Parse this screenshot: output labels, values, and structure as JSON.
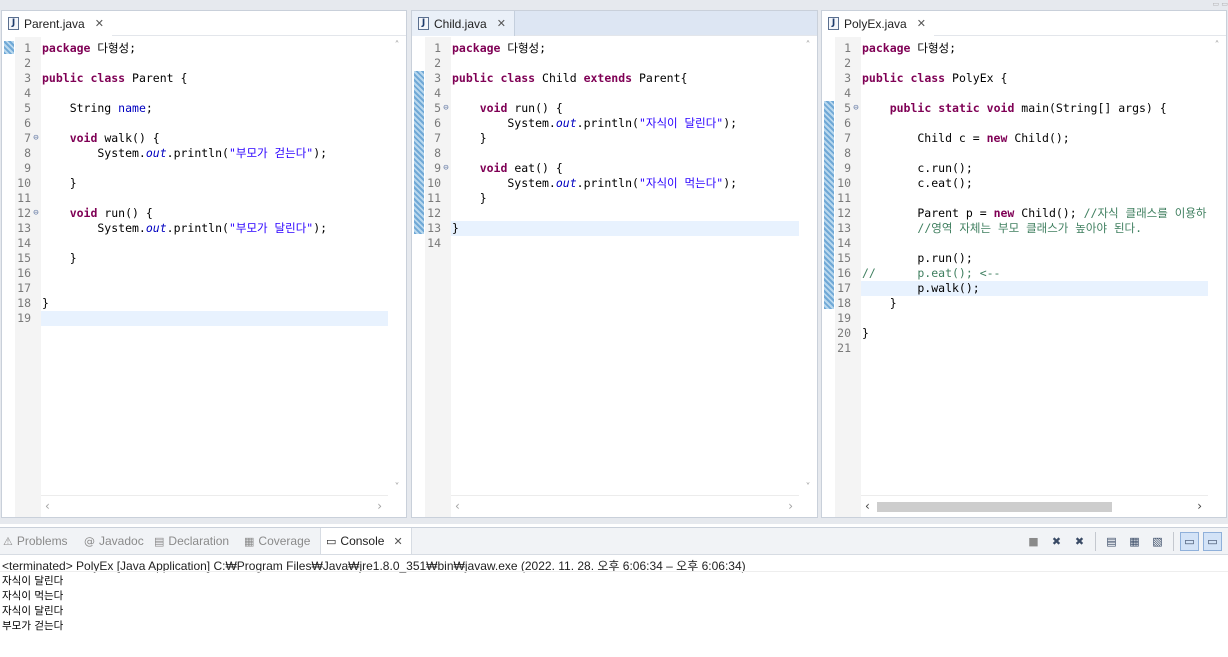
{
  "editors": [
    {
      "tab_label": "Parent.java",
      "lines": [
        {
          "n": "1",
          "html": "<span class=\"kw\">package</span> 다형성;"
        },
        {
          "n": "2",
          "html": ""
        },
        {
          "n": "3",
          "html": "<span class=\"kw\">public</span> <span class=\"kw\">class</span> Parent {"
        },
        {
          "n": "4",
          "html": ""
        },
        {
          "n": "5",
          "html": "    String <span class=\"fld\">name</span>;"
        },
        {
          "n": "6",
          "html": ""
        },
        {
          "n": "7",
          "fold": "⊖",
          "html": "    <span class=\"kw\">void</span> walk() {"
        },
        {
          "n": "8",
          "html": "        System.<span class=\"stat\">out</span>.println(<span class=\"str\">\"부모가 걷는다\"</span>);"
        },
        {
          "n": "9",
          "html": ""
        },
        {
          "n": "10",
          "html": "    }"
        },
        {
          "n": "11",
          "html": ""
        },
        {
          "n": "12",
          "fold": "⊖",
          "html": "    <span class=\"kw\">void</span> run() {"
        },
        {
          "n": "13",
          "html": "        System.<span class=\"stat\">out</span>.println(<span class=\"str\">\"부모가 달린다\"</span>);"
        },
        {
          "n": "14",
          "html": ""
        },
        {
          "n": "15",
          "html": "    }"
        },
        {
          "n": "16",
          "html": ""
        },
        {
          "n": "17",
          "html": ""
        },
        {
          "n": "18",
          "html": "}"
        },
        {
          "n": "19",
          "html": "",
          "cur": true
        }
      ]
    },
    {
      "tab_label": "Child.java",
      "lines": [
        {
          "n": "1",
          "html": "<span class=\"kw\">package</span> 다형성;"
        },
        {
          "n": "2",
          "html": ""
        },
        {
          "n": "3",
          "html": "<span class=\"kw\">public</span> <span class=\"kw\">class</span> Child <span class=\"kw\">extends</span> Parent{"
        },
        {
          "n": "4",
          "html": ""
        },
        {
          "n": "5",
          "fold": "⊖",
          "html": "    <span class=\"kw\">void</span> run() {"
        },
        {
          "n": "6",
          "html": "        System.<span class=\"stat\">out</span>.println(<span class=\"str\">\"자식이 달린다\"</span>);"
        },
        {
          "n": "7",
          "html": "    }"
        },
        {
          "n": "8",
          "html": ""
        },
        {
          "n": "9",
          "fold": "⊖",
          "html": "    <span class=\"kw\">void</span> eat() {"
        },
        {
          "n": "10",
          "html": "        System.<span class=\"stat\">out</span>.println(<span class=\"str\">\"자식이 먹는다\"</span>);"
        },
        {
          "n": "11",
          "html": "    }"
        },
        {
          "n": "12",
          "html": ""
        },
        {
          "n": "13",
          "html": "}",
          "cur": true
        },
        {
          "n": "14",
          "html": ""
        }
      ]
    },
    {
      "tab_label": "PolyEx.java",
      "lines": [
        {
          "n": "1",
          "html": "<span class=\"kw\">package</span> 다형성;"
        },
        {
          "n": "2",
          "html": ""
        },
        {
          "n": "3",
          "html": "<span class=\"kw\">public</span> <span class=\"kw\">class</span> PolyEx {"
        },
        {
          "n": "4",
          "html": ""
        },
        {
          "n": "5",
          "fold": "⊖",
          "html": "    <span class=\"kw\">public</span> <span class=\"kw\">static</span> <span class=\"kw\">void</span> main(String[] args) {"
        },
        {
          "n": "6",
          "html": ""
        },
        {
          "n": "7",
          "html": "        Child c = <span class=\"kw\">new</span> Child();"
        },
        {
          "n": "8",
          "html": ""
        },
        {
          "n": "9",
          "html": "        c.run();"
        },
        {
          "n": "10",
          "html": "        c.eat();"
        },
        {
          "n": "11",
          "html": ""
        },
        {
          "n": "12",
          "html": "        Parent p = <span class=\"kw\">new</span> Child(); <span class=\"cm\">//자식 클래스를 이용하</span>"
        },
        {
          "n": "13",
          "html": "        <span class=\"cm\">//영역 자체는 부모 클래스가 높아야 된다.</span>"
        },
        {
          "n": "14",
          "html": ""
        },
        {
          "n": "15",
          "html": "        p.run();"
        },
        {
          "n": "16",
          "html": "<span class=\"cm\">//      p.eat(); <--</span>"
        },
        {
          "n": "17",
          "html": "        p.walk();",
          "cur": true
        },
        {
          "n": "18",
          "html": "    }"
        },
        {
          "n": "19",
          "html": ""
        },
        {
          "n": "20",
          "html": "}"
        },
        {
          "n": "21",
          "html": ""
        }
      ]
    }
  ],
  "console": {
    "tabs": [
      {
        "label": "Problems",
        "icon": "problems-icon",
        "glyph": "⚠"
      },
      {
        "label": "Javadoc",
        "icon": "javadoc-icon",
        "glyph": "@"
      },
      {
        "label": "Declaration",
        "icon": "declaration-icon",
        "glyph": "▤"
      },
      {
        "label": "Coverage",
        "icon": "coverage-icon",
        "glyph": "▦"
      },
      {
        "label": "Console",
        "icon": "console-icon",
        "glyph": "▭",
        "active": true
      }
    ],
    "toolbar": [
      {
        "name": "terminate-icon",
        "glyph": "■"
      },
      {
        "name": "remove-launch-icon",
        "glyph": "✖"
      },
      {
        "name": "remove-all-icon",
        "glyph": "✖"
      },
      {
        "name": "clear-console-icon",
        "glyph": "▤"
      },
      {
        "name": "scroll-lock-icon",
        "glyph": "▦"
      },
      {
        "name": "word-wrap-icon",
        "glyph": "▧"
      },
      {
        "name": "show-on-output-icon",
        "glyph": "▭",
        "on": true
      },
      {
        "name": "show-on-error-icon",
        "glyph": "▭",
        "on": true
      }
    ],
    "header": "<terminated> PolyEx [Java Application] C:₩Program Files₩Java₩jre1.8.0_351₩bin₩javaw.exe  (2022. 11. 28. 오후 6:06:34 – 오후 6:06:34)",
    "output": [
      "자식이 달린다",
      "자식이 먹는다",
      "자식이 달린다",
      "부모가 걷는다"
    ]
  }
}
